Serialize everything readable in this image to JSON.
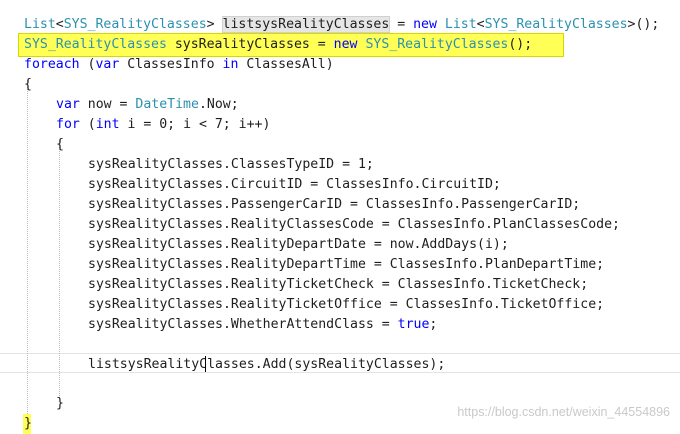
{
  "code": {
    "l1_type_a": "List",
    "l1_lt": "<",
    "l1_type_b": "SYS_RealityClasses",
    "l1_gt": ">",
    "l1_space": " ",
    "l1_var": "listsysRealityClasses",
    "l1_eq": " = ",
    "l1_new": "new",
    "l1_space2": " ",
    "l1_type_c": "List",
    "l1_lt2": "<",
    "l1_type_d": "SYS_RealityClasses",
    "l1_end": ">();",
    "l2_type": "SYS_RealityClasses",
    "l2_mid": " sysRealityClasses = ",
    "l2_new": "new",
    "l2_space": " ",
    "l2_type2": "SYS_RealityClasses",
    "l2_end": "();",
    "l3_kw": "foreach",
    "l3_open": " (",
    "l3_kw2": "var",
    "l3_mid": " ClassesInfo ",
    "l3_kw3": "in",
    "l3_end": " ClassesAll)",
    "l4": "{",
    "l5_kw": "var",
    "l5_mid": " now = ",
    "l5_type": "DateTime",
    "l5_end": ".Now;",
    "l6_kw": "for",
    "l6_open": " (",
    "l6_kw2": "int",
    "l6_end": " i = 0; i < 7; i++)",
    "l7": "{",
    "l8": "sysRealityClasses.ClassesTypeID = 1;",
    "l9": "sysRealityClasses.CircuitID = ClassesInfo.CircuitID;",
    "l10": "sysRealityClasses.PassengerCarID = ClassesInfo.PassengerCarID;",
    "l11": "sysRealityClasses.RealityClassesCode = ClassesInfo.PlanClassesCode;",
    "l12": "sysRealityClasses.RealityDepartDate = now.AddDays(i);",
    "l13": "sysRealityClasses.RealityDepartTime = ClassesInfo.PlanDepartTime;",
    "l14": "sysRealityClasses.RealityTicketCheck = ClassesInfo.TicketCheck;",
    "l15": "sysRealityClasses.RealityTicketOffice = ClassesInfo.TicketOffice;",
    "l16_a": "sysRealityClasses.WhetherAttendClass = ",
    "l16_kw": "true",
    "l16_end": ";",
    "l18": "listsysRealityClasses.Add(sysRealityClasses);",
    "l20": "}",
    "l21": "}"
  },
  "watermark": "https://blog.csdn.net/weixin_44554896",
  "colors": {
    "keyword": "#0000ff",
    "type": "#2b91af",
    "highlight": "#ffff55",
    "text": "#1e1e1e"
  }
}
